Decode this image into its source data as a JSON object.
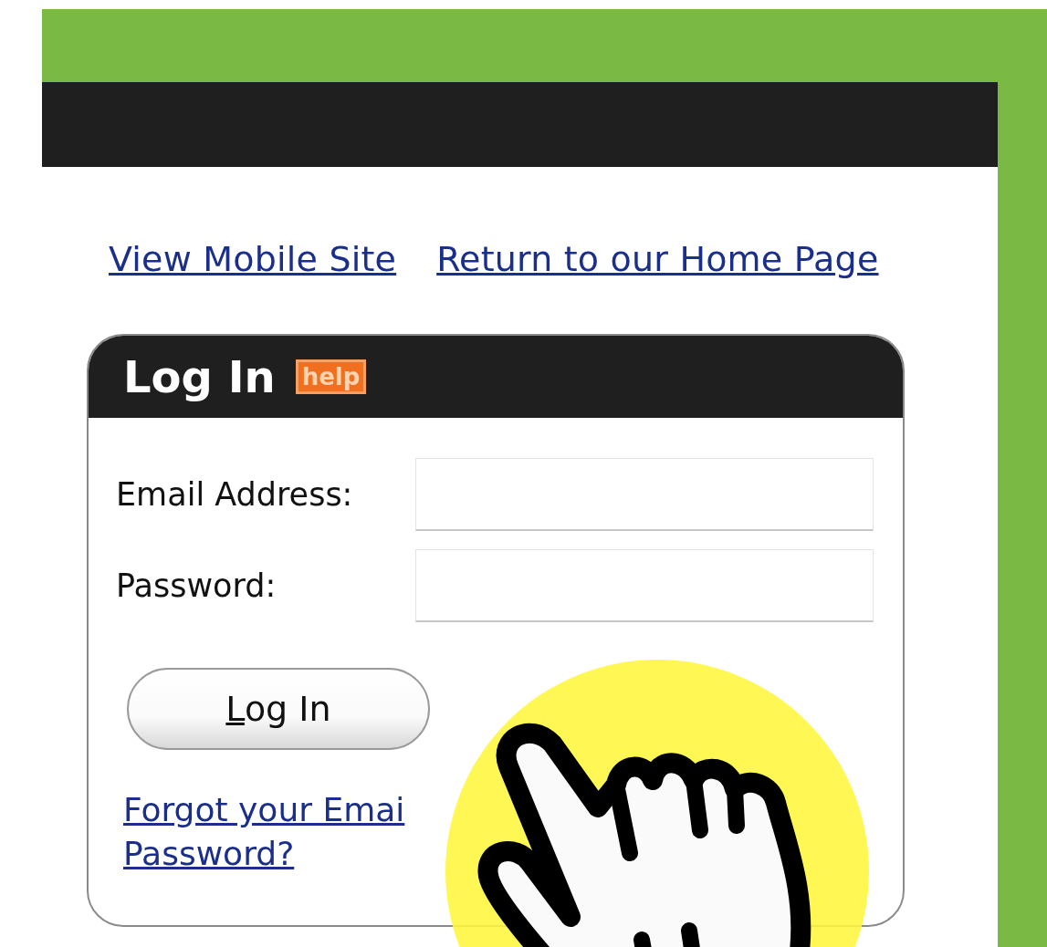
{
  "top_links": [
    {
      "label": "View Mobile Site"
    },
    {
      "label": "Return to our Home Page"
    }
  ],
  "login": {
    "title": "Log In",
    "help": "help",
    "fields": [
      {
        "label": "Email Address:"
      },
      {
        "label": "Password:"
      }
    ],
    "button": "Log In",
    "forgot_link": [
      "Forgot your Emai",
      "Password?"
    ]
  }
}
